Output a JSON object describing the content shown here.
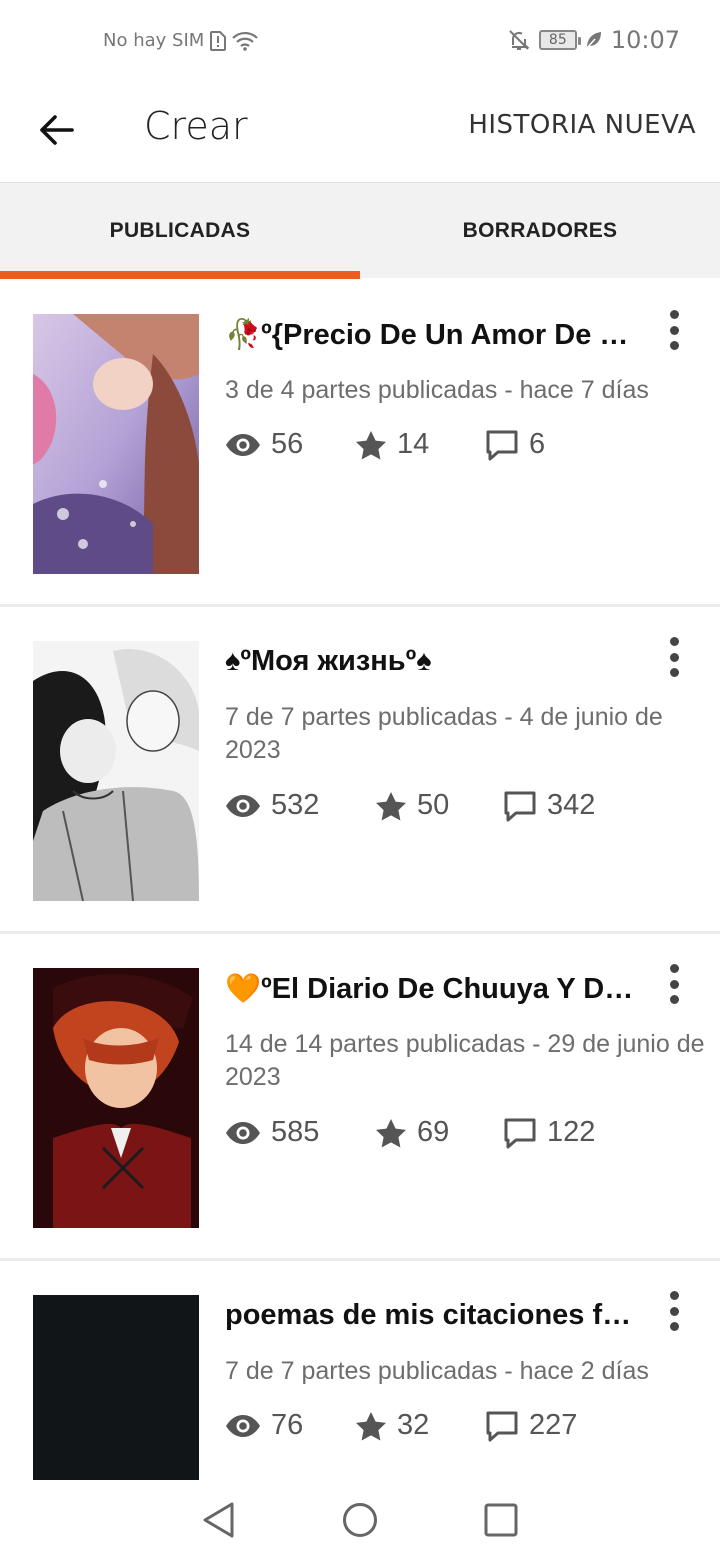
{
  "status_bar": {
    "carrier": "No hay SIM",
    "battery": "85",
    "time": "10:07"
  },
  "app_bar": {
    "title": "Crear",
    "action": "HISTORIA NUEVA"
  },
  "tabs": [
    {
      "label": "PUBLICADAS",
      "active": true
    },
    {
      "label": "BORRADORES",
      "active": false
    }
  ],
  "stories": [
    {
      "title": "🥀º{Precio De Un Amor De Lobo",
      "meta": "3 de 4 partes publicadas - hace 7 días",
      "reads": "56",
      "votes": "14",
      "comments": "6"
    },
    {
      "title": "♠ºМоя жизньº♠",
      "meta": "7 de 7 partes publicadas - 4 de junio de 2023",
      "reads": "532",
      "votes": "50",
      "comments": "342"
    },
    {
      "title": "🧡ºEl Diario De Chuuya Y Dazai",
      "meta": "14 de 14 partes publicadas - 29 de junio de 2023",
      "reads": "585",
      "votes": "69",
      "comments": "122"
    },
    {
      "title": "poemas de mis citaciones favoritas",
      "meta": "7 de 7 partes publicadas - hace 2 días",
      "reads": "76",
      "votes": "32",
      "comments": "227"
    }
  ],
  "colors": {
    "accent": "#f05a1c",
    "tab_bg": "#f2f2f2",
    "meta_text": "#6d6d6d"
  }
}
